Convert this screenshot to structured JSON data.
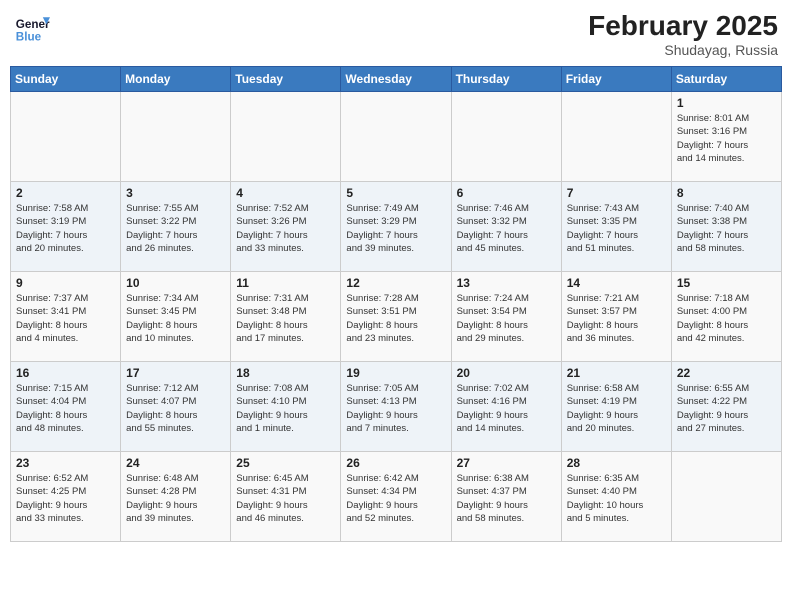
{
  "header": {
    "logo_line1": "General",
    "logo_line2": "Blue",
    "month_title": "February 2025",
    "location": "Shudayag, Russia"
  },
  "weekdays": [
    "Sunday",
    "Monday",
    "Tuesday",
    "Wednesday",
    "Thursday",
    "Friday",
    "Saturday"
  ],
  "weeks": [
    [
      {
        "day": "",
        "info": ""
      },
      {
        "day": "",
        "info": ""
      },
      {
        "day": "",
        "info": ""
      },
      {
        "day": "",
        "info": ""
      },
      {
        "day": "",
        "info": ""
      },
      {
        "day": "",
        "info": ""
      },
      {
        "day": "1",
        "info": "Sunrise: 8:01 AM\nSunset: 3:16 PM\nDaylight: 7 hours\nand 14 minutes."
      }
    ],
    [
      {
        "day": "2",
        "info": "Sunrise: 7:58 AM\nSunset: 3:19 PM\nDaylight: 7 hours\nand 20 minutes."
      },
      {
        "day": "3",
        "info": "Sunrise: 7:55 AM\nSunset: 3:22 PM\nDaylight: 7 hours\nand 26 minutes."
      },
      {
        "day": "4",
        "info": "Sunrise: 7:52 AM\nSunset: 3:26 PM\nDaylight: 7 hours\nand 33 minutes."
      },
      {
        "day": "5",
        "info": "Sunrise: 7:49 AM\nSunset: 3:29 PM\nDaylight: 7 hours\nand 39 minutes."
      },
      {
        "day": "6",
        "info": "Sunrise: 7:46 AM\nSunset: 3:32 PM\nDaylight: 7 hours\nand 45 minutes."
      },
      {
        "day": "7",
        "info": "Sunrise: 7:43 AM\nSunset: 3:35 PM\nDaylight: 7 hours\nand 51 minutes."
      },
      {
        "day": "8",
        "info": "Sunrise: 7:40 AM\nSunset: 3:38 PM\nDaylight: 7 hours\nand 58 minutes."
      }
    ],
    [
      {
        "day": "9",
        "info": "Sunrise: 7:37 AM\nSunset: 3:41 PM\nDaylight: 8 hours\nand 4 minutes."
      },
      {
        "day": "10",
        "info": "Sunrise: 7:34 AM\nSunset: 3:45 PM\nDaylight: 8 hours\nand 10 minutes."
      },
      {
        "day": "11",
        "info": "Sunrise: 7:31 AM\nSunset: 3:48 PM\nDaylight: 8 hours\nand 17 minutes."
      },
      {
        "day": "12",
        "info": "Sunrise: 7:28 AM\nSunset: 3:51 PM\nDaylight: 8 hours\nand 23 minutes."
      },
      {
        "day": "13",
        "info": "Sunrise: 7:24 AM\nSunset: 3:54 PM\nDaylight: 8 hours\nand 29 minutes."
      },
      {
        "day": "14",
        "info": "Sunrise: 7:21 AM\nSunset: 3:57 PM\nDaylight: 8 hours\nand 36 minutes."
      },
      {
        "day": "15",
        "info": "Sunrise: 7:18 AM\nSunset: 4:00 PM\nDaylight: 8 hours\nand 42 minutes."
      }
    ],
    [
      {
        "day": "16",
        "info": "Sunrise: 7:15 AM\nSunset: 4:04 PM\nDaylight: 8 hours\nand 48 minutes."
      },
      {
        "day": "17",
        "info": "Sunrise: 7:12 AM\nSunset: 4:07 PM\nDaylight: 8 hours\nand 55 minutes."
      },
      {
        "day": "18",
        "info": "Sunrise: 7:08 AM\nSunset: 4:10 PM\nDaylight: 9 hours\nand 1 minute."
      },
      {
        "day": "19",
        "info": "Sunrise: 7:05 AM\nSunset: 4:13 PM\nDaylight: 9 hours\nand 7 minutes."
      },
      {
        "day": "20",
        "info": "Sunrise: 7:02 AM\nSunset: 4:16 PM\nDaylight: 9 hours\nand 14 minutes."
      },
      {
        "day": "21",
        "info": "Sunrise: 6:58 AM\nSunset: 4:19 PM\nDaylight: 9 hours\nand 20 minutes."
      },
      {
        "day": "22",
        "info": "Sunrise: 6:55 AM\nSunset: 4:22 PM\nDaylight: 9 hours\nand 27 minutes."
      }
    ],
    [
      {
        "day": "23",
        "info": "Sunrise: 6:52 AM\nSunset: 4:25 PM\nDaylight: 9 hours\nand 33 minutes."
      },
      {
        "day": "24",
        "info": "Sunrise: 6:48 AM\nSunset: 4:28 PM\nDaylight: 9 hours\nand 39 minutes."
      },
      {
        "day": "25",
        "info": "Sunrise: 6:45 AM\nSunset: 4:31 PM\nDaylight: 9 hours\nand 46 minutes."
      },
      {
        "day": "26",
        "info": "Sunrise: 6:42 AM\nSunset: 4:34 PM\nDaylight: 9 hours\nand 52 minutes."
      },
      {
        "day": "27",
        "info": "Sunrise: 6:38 AM\nSunset: 4:37 PM\nDaylight: 9 hours\nand 58 minutes."
      },
      {
        "day": "28",
        "info": "Sunrise: 6:35 AM\nSunset: 4:40 PM\nDaylight: 10 hours\nand 5 minutes."
      },
      {
        "day": "",
        "info": ""
      }
    ]
  ]
}
